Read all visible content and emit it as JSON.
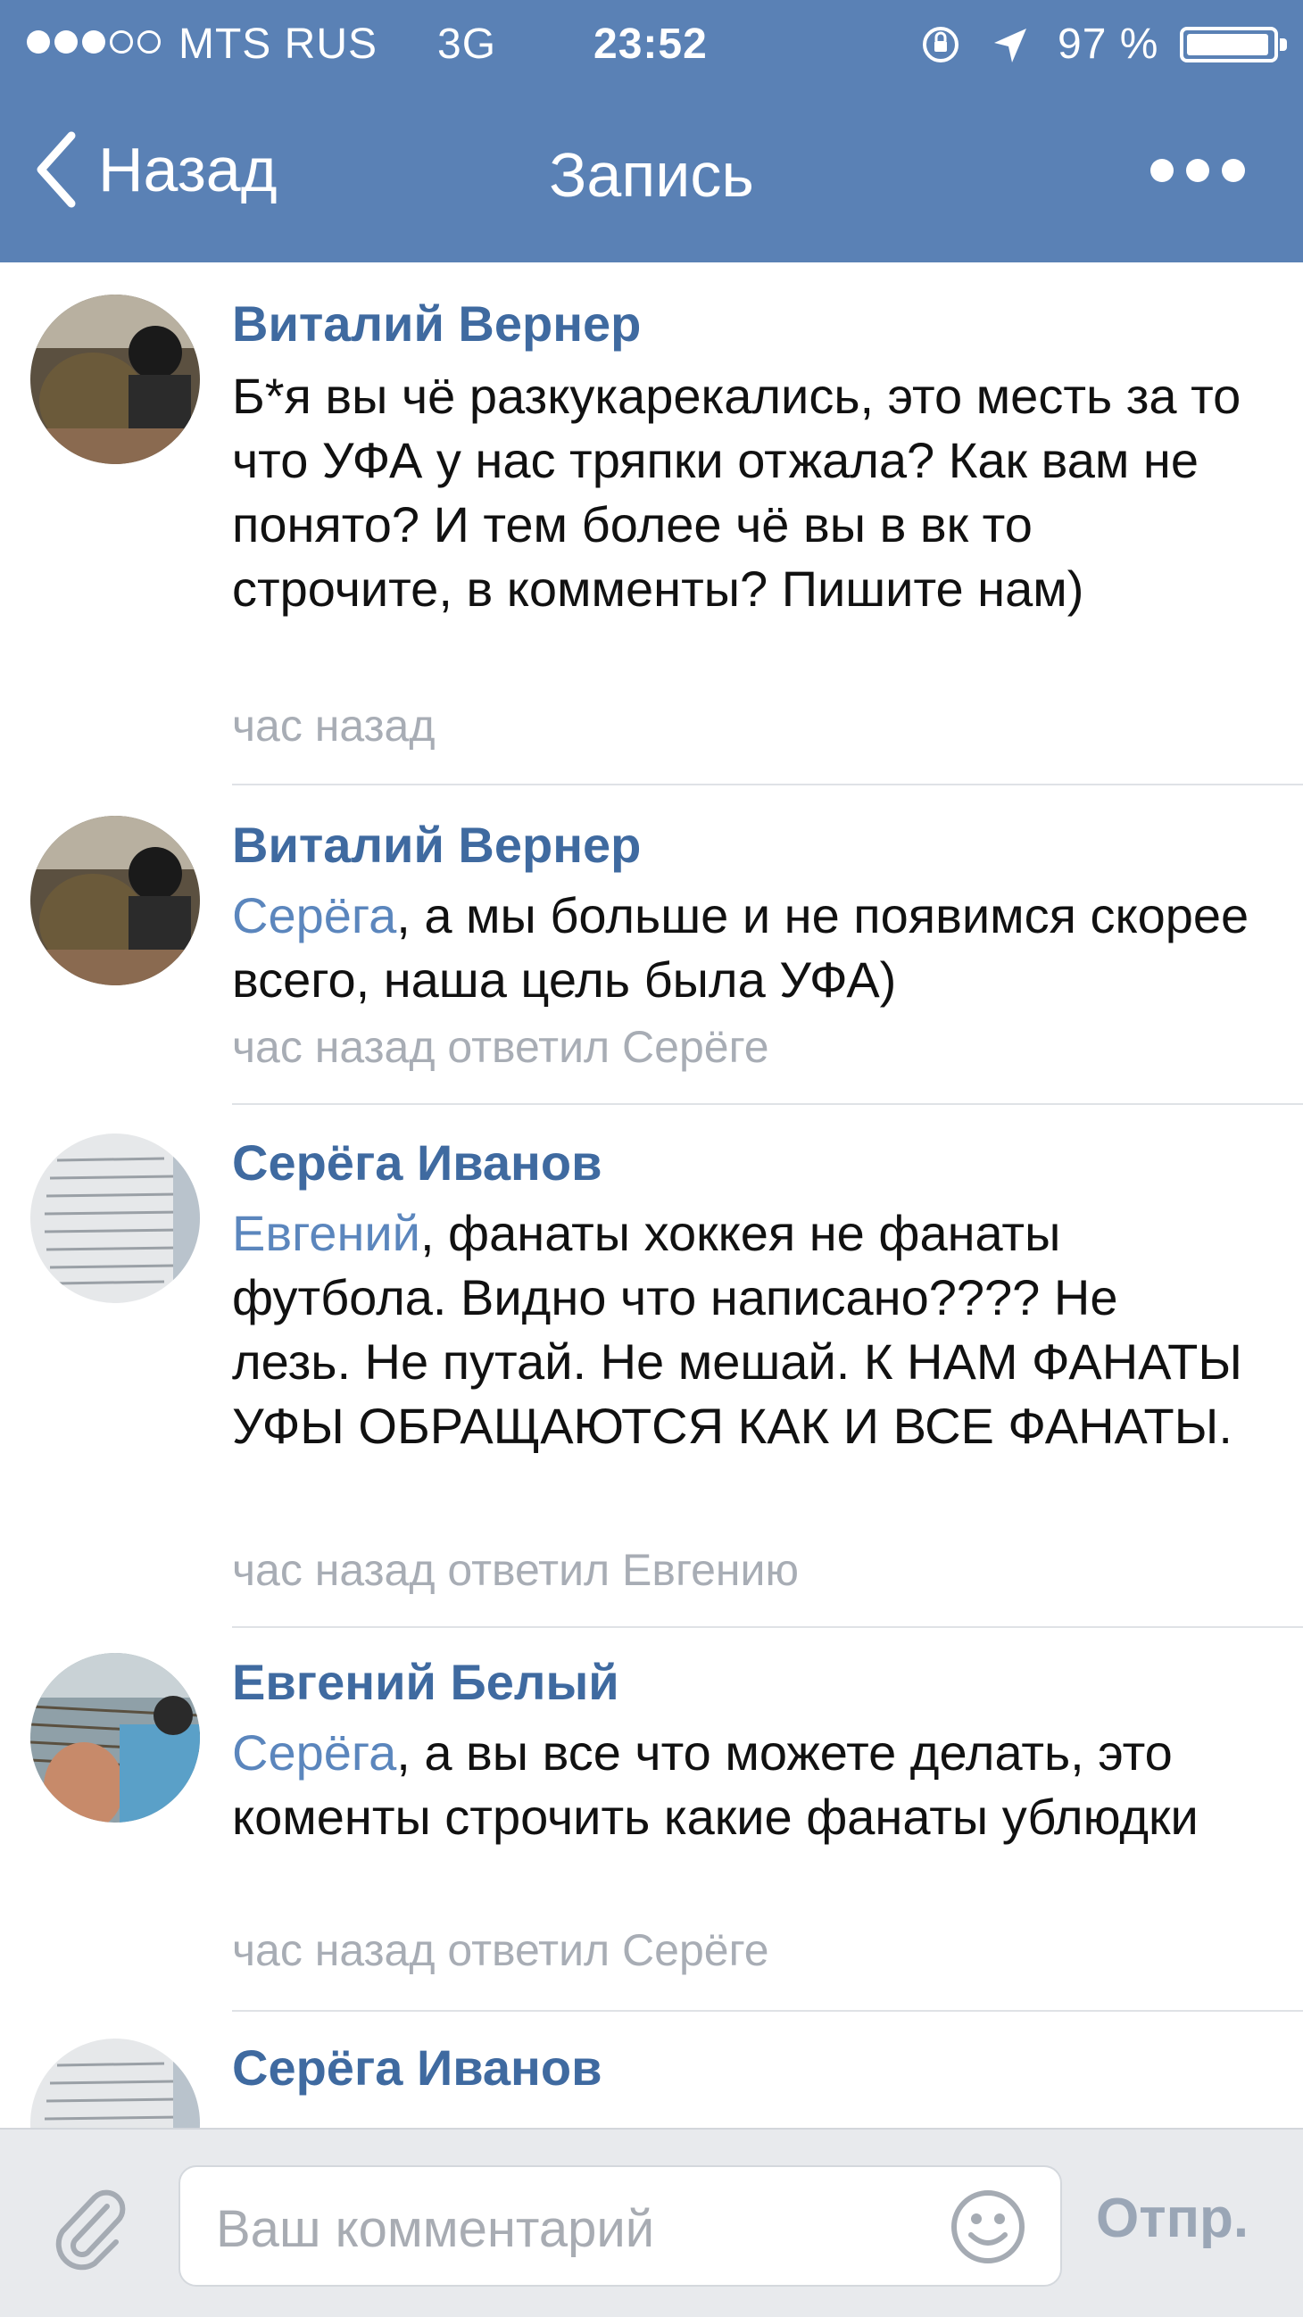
{
  "status_bar": {
    "carrier": "MTS RUS",
    "network": "3G",
    "time": "23:52",
    "battery": "97 %",
    "battery_level": 0.97
  },
  "nav": {
    "back_label": "Назад",
    "title": "Запись"
  },
  "comments": [
    {
      "author": "Виталий Вернер",
      "mention": "",
      "text": "Б*я вы чё разкукарекались, это месть за то что УФА у нас тряпки отжала? Как вам не понято? И тем более чё вы в вк то строчите, в комменты? Пишите нам)",
      "meta": "час назад"
    },
    {
      "author": "Виталий Вернер",
      "mention": "Серёга",
      "text": ", а мы больше и не появимся скорее всего, наша цель была УФА)",
      "meta": "час назад ответил Серёге"
    },
    {
      "author": "Серёга Иванов",
      "mention": "Евгений",
      "text": ", фанаты хоккея не фанаты футбола.  Видно что написано????  Не лезь.  Не путай.  Не мешай.  К НАМ ФАНАТЫ УФЫ ОБРАЩАЮТСЯ КАК И ВСЕ ФАНАТЫ.",
      "meta": "час назад ответил Евгению"
    },
    {
      "author": "Евгений Белый",
      "mention": "Серёга",
      "text": ", а вы все что можете делать, это коменты строчить какие фанаты ублюдки",
      "meta": "час назад ответил Серёге"
    },
    {
      "author": "Серёга Иванов",
      "mention": "",
      "text": "",
      "meta": ""
    }
  ],
  "compose": {
    "placeholder": "Ваш комментарий",
    "send_label": "Отпр."
  },
  "colors": {
    "header_bg": "#5a81b5",
    "author": "#3f6aa0",
    "mention": "#5b86bd",
    "meta": "#a8adb5"
  }
}
